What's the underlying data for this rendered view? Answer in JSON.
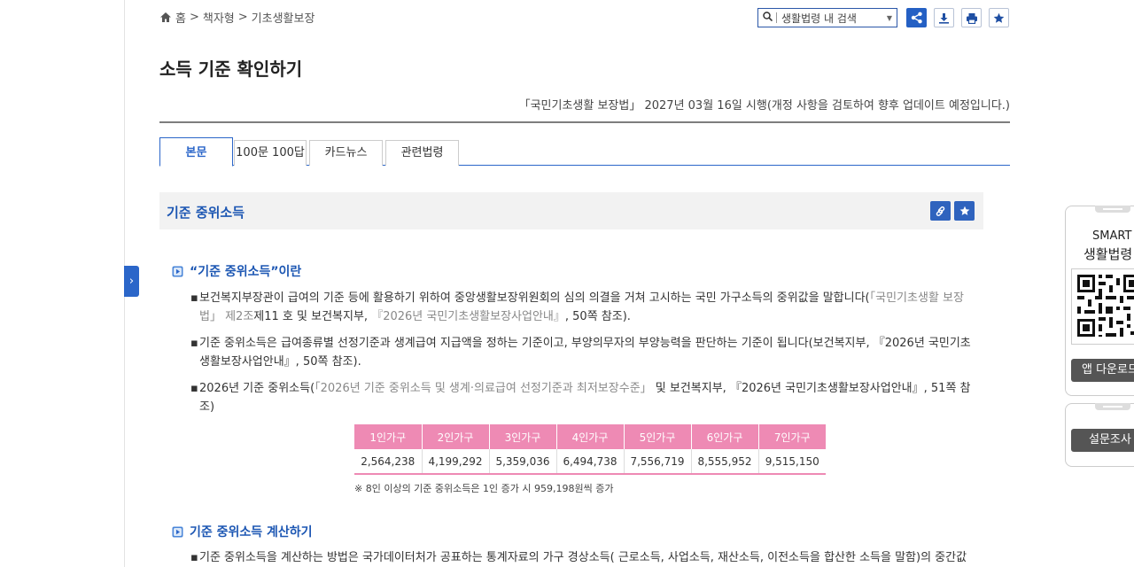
{
  "breadcrumb": {
    "home": "홈",
    "sep1": ">",
    "item1": "책자형",
    "sep2": ">",
    "item2": "기초생활보장"
  },
  "search": {
    "placeholder": "생활법령 내 검색"
  },
  "page": {
    "title": "소득 기준 확인하기",
    "law_note": "「국민기초생활 보장법」 2027년 03월 16일 시행(개정 사항을 검토하여 향후 업데이트 예정입니다.)"
  },
  "tabs": [
    {
      "label": "본문"
    },
    {
      "label": "100문 100답"
    },
    {
      "label": "카드뉴스"
    },
    {
      "label": "관련법령"
    }
  ],
  "section": {
    "title": "기준 중위소득"
  },
  "sub1": {
    "title": "“기준 중위소득”이란",
    "b1": {
      "a": "보건복지부장관이 급여의 기준 등에 활용하기 위하여 중앙생활보장위원회의 심의 의결을 거쳐 고시하는 국민 가구소득의 중위값을 말합니다(",
      "b": "「국민기초생활 보장법」 제2조",
      "c": "제11 호 및 보건복지부, ",
      "d": "『2026년 국민기초생활보장사업안내』",
      "e": ", 50쪽 참조)."
    },
    "b2": "기준 중위소득은 급여종류별 선정기준과 생계급여 지급액을 정하는 기준이고, 부양의무자의 부양능력을 판단하는 기준이 됩니다(보건복지부, 『2026년 국민기초생활보장사업안내』, 50쪽 참조).",
    "b3": {
      "a": "2026년 기준 중위소득(",
      "b": "「2026년 기준 중위소득 및 생계·의료급여 선정기준과 최저보장수준」",
      "c": " 및 보건복지부, 『2026년 국민기초생활보장사업안내』, 51쪽 참조)"
    }
  },
  "income_table": {
    "headers": [
      "1인가구",
      "2인가구",
      "3인가구",
      "4인가구",
      "5인가구",
      "6인가구",
      "7인가구"
    ],
    "values": [
      "2,564,238",
      "4,199,292",
      "5,359,036",
      "6,494,738",
      "7,556,719",
      "8,555,952",
      "9,515,150"
    ],
    "note": "※ 8인 이상의 기준 중위소득은 1인 증가 시 959,198원씩 증가"
  },
  "sub2": {
    "title": "기준 중위소득 계산하기",
    "b1": "기준 중위소득을 계산하는 방법은 국가데이터처가 공표하는 통계자료의 가구 경상소득( 근로소득, 사업소득, 재산소득, 이전소득을 합산한 소득을 말함)의 중간값"
  },
  "side": {
    "smart_l1": "SMART",
    "smart_l2": "생활법령",
    "app_download": "앱 다운로드",
    "survey": "설문조사"
  },
  "colors": {
    "accent": "#2b66c9",
    "table_header": "#ee8ab4"
  }
}
